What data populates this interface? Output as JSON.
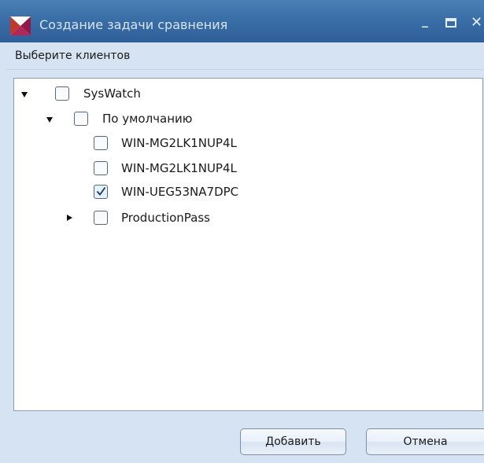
{
  "window": {
    "title": "Создание задачи сравнения",
    "minimize_glyph": "_",
    "close_glyph": "✕",
    "app_icon": "envelope-logo-icon"
  },
  "section": {
    "label": "Выберите клиентов"
  },
  "tree": {
    "items": [
      {
        "label": "SysWatch",
        "expanded": true,
        "checked": false,
        "level": 0
      },
      {
        "label": "По умолчанию",
        "expanded": true,
        "checked": false,
        "level": 1
      },
      {
        "label": "WIN-MG2LK1NUP4L",
        "checked": false,
        "level": 2
      },
      {
        "label": "WIN-MG2LK1NUP4L",
        "checked": false,
        "level": 2
      },
      {
        "label": "WIN-UEG53NA7DPC",
        "checked": true,
        "level": 2
      },
      {
        "label": "ProductionPass",
        "expanded": false,
        "checked": false,
        "level": 1
      }
    ]
  },
  "buttons": {
    "add_label": "Добавить",
    "cancel_label": "Отмена"
  },
  "colors": {
    "titlebar": "#3a6ea6",
    "window_bg": "#d6e3f3",
    "panel_bg": "#ffffff"
  }
}
